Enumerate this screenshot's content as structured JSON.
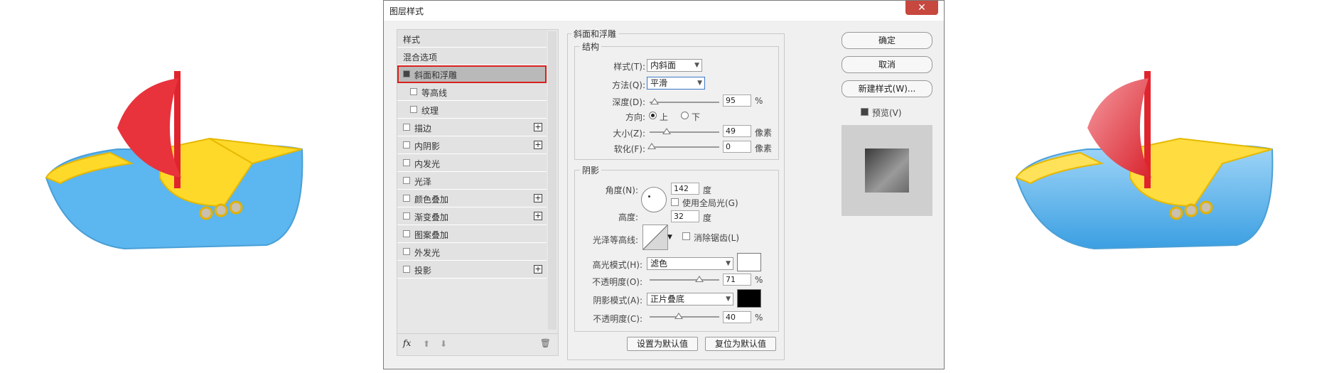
{
  "dialog": {
    "title": "图层样式",
    "close": "✕"
  },
  "styles_list": {
    "header": "样式",
    "blend": "混合选项",
    "items": [
      {
        "label": "斜面和浮雕",
        "checked": true,
        "plus": false,
        "selected": true
      },
      {
        "label": "等高线",
        "checked": false,
        "plus": false,
        "sub": true
      },
      {
        "label": "纹理",
        "checked": false,
        "plus": false,
        "sub": true
      },
      {
        "label": "描边",
        "checked": false,
        "plus": true
      },
      {
        "label": "内阴影",
        "checked": false,
        "plus": true
      },
      {
        "label": "内发光",
        "checked": false,
        "plus": false
      },
      {
        "label": "光泽",
        "checked": false,
        "plus": false
      },
      {
        "label": "颜色叠加",
        "checked": false,
        "plus": true
      },
      {
        "label": "渐变叠加",
        "checked": false,
        "plus": true
      },
      {
        "label": "图案叠加",
        "checked": false,
        "plus": false
      },
      {
        "label": "外发光",
        "checked": false,
        "plus": false
      },
      {
        "label": "投影",
        "checked": false,
        "plus": true
      }
    ],
    "footer_fx": "fx",
    "footer_icons": [
      "fx-icon",
      "move-up-icon",
      "move-down-icon",
      "trash-icon"
    ]
  },
  "bevel": {
    "section": "斜面和浮雕",
    "structure": "结构",
    "style_label": "样式(T):",
    "style_value": "内斜面",
    "method_label": "方法(Q):",
    "method_value": "平滑",
    "depth_label": "深度(D):",
    "depth_value": "95",
    "depth_unit": "%",
    "direction_label": "方向:",
    "direction_up": "上",
    "direction_down": "下",
    "size_label": "大小(Z):",
    "size_value": "49",
    "size_unit": "像素",
    "soften_label": "软化(F):",
    "soften_value": "0",
    "soften_unit": "像素"
  },
  "shading": {
    "section": "阴影",
    "angle_label": "角度(N):",
    "angle_value": "142",
    "angle_unit": "度",
    "global_light": "使用全局光(G)",
    "altitude_label": "高度:",
    "altitude_value": "32",
    "altitude_unit": "度",
    "gloss_label": "光泽等高线:",
    "antialias": "消除锯齿(L)",
    "highlight_label": "高光模式(H):",
    "highlight_value": "滤色",
    "highlight_color": "#ffffff",
    "hl_opacity_label": "不透明度(O):",
    "hl_opacity_value": "71",
    "hl_opacity_unit": "%",
    "shadow_label": "阴影模式(A):",
    "shadow_value": "正片叠底",
    "shadow_color": "#000000",
    "sh_opacity_label": "不透明度(C):",
    "sh_opacity_value": "40",
    "sh_opacity_unit": "%"
  },
  "buttons": {
    "set_default": "设置为默认值",
    "reset_default": "复位为默认值",
    "ok": "确定",
    "cancel": "取消",
    "new_style": "新建样式(W)...",
    "preview": "预览(V)"
  }
}
